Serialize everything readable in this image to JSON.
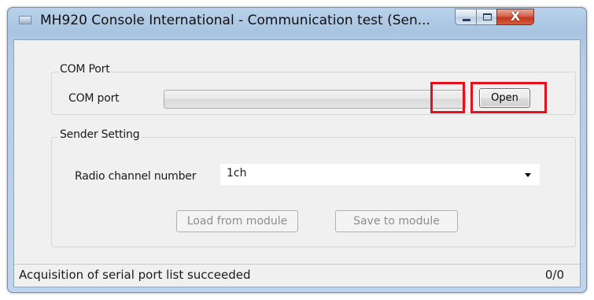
{
  "window": {
    "title": "MH920 Console International - Communication test (Sen...",
    "close_glyph": "X"
  },
  "com_port_group": {
    "title": "COM Port",
    "label": "COM port",
    "selected_value": "",
    "open_button": "Open"
  },
  "sender_group": {
    "title": "Sender Setting",
    "radio_channel_label": "Radio channel number",
    "radio_channel_value": "1ch",
    "load_button": "Load from module",
    "save_button": "Save to module"
  },
  "status": {
    "message": "Acquisition of serial port list succeeded",
    "count": "0/0"
  },
  "colors": {
    "highlight": "#e3101d",
    "close_button": "#c2381e"
  }
}
